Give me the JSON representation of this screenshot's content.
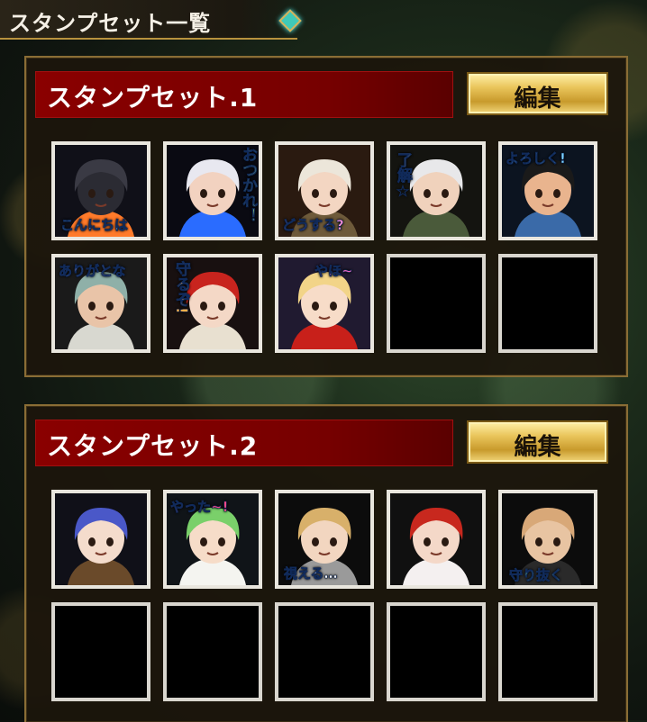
{
  "header": {
    "title": "スタンプセット一覧"
  },
  "sets": [
    {
      "title": "スタンプセット.1",
      "edit_label": "編集",
      "stamps": [
        {
          "text": "こんにちは",
          "text_color": "#7fd6ff",
          "hair": "#3a3a44",
          "skin": "#2b2b33",
          "accent": "#ff7a2a",
          "bg": "#101018",
          "icon": "armored-maid-icon"
        },
        {
          "text": "おつかれ！",
          "text_color": "#b7ff8a",
          "hair": "#e8e8f0",
          "skin": "#f2d2c0",
          "accent": "#2a6cff",
          "bg": "#0a0a12",
          "icon": "glasses-girl-icon"
        },
        {
          "text": "どうする?",
          "text_color": "#ff8fd6",
          "hair": "#ece6da",
          "skin": "#f3d6c2",
          "accent": "#6e5a3a",
          "bg": "#2a1a10",
          "icon": "goggles-girl-icon"
        },
        {
          "text": "了解☆",
          "text_color": "#ffd36a",
          "hair": "#e8e8ea",
          "skin": "#f0d2bc",
          "accent": "#4a5a3a",
          "bg": "#141410",
          "icon": "white-hair-boy-icon"
        },
        {
          "text": "よろしく!",
          "text_color": "#7fd6ff",
          "hair": "#1a1a1a",
          "skin": "#e9b48e",
          "accent": "#3a6aa8",
          "bg": "#0c1420",
          "icon": "thumbs-up-boy-icon"
        },
        {
          "text": "ありがとな",
          "text_color": "#e6c8ff",
          "hair": "#8fb0a8",
          "skin": "#e9c4a8",
          "accent": "#d8d8d0",
          "bg": "#1a1a1a",
          "icon": "grey-hair-man-icon"
        },
        {
          "text": "守るぞ!",
          "text_color": "#ffb04a",
          "hair": "#c8241e",
          "skin": "#f4d8c6",
          "accent": "#e8e0d0",
          "bg": "#181010",
          "icon": "horned-girl-icon"
        },
        {
          "text": "やほ~",
          "text_color": "#ff6ac8",
          "hair": "#f2d488",
          "skin": "#f7dcc8",
          "accent": "#c8201a",
          "bg": "#201a30",
          "icon": "blonde-girl-icon"
        },
        {
          "text": "",
          "text_color": "",
          "empty": true
        },
        {
          "text": "",
          "text_color": "",
          "empty": true
        }
      ]
    },
    {
      "title": "スタンプセット.2",
      "edit_label": "編集",
      "stamps": [
        {
          "text": "",
          "text_color": "#ffffff",
          "hair": "#4a58c8",
          "skin": "#f4dccc",
          "accent": "#6a4a2a",
          "bg": "#101018",
          "icon": "witch-girl-icon"
        },
        {
          "text": "やった~!",
          "text_color": "#ff4a8a",
          "hair": "#7ad06a",
          "skin": "#f6dcc8",
          "accent": "#f4f4f0",
          "bg": "#101418",
          "icon": "green-hair-girl-icon"
        },
        {
          "text": "視える…",
          "text_color": "#ffffff",
          "hair": "#d8b06a",
          "skin": "#f2d6c0",
          "accent": "#9a9a9a",
          "bg": "#0c0c0c",
          "icon": "hooded-boy-icon"
        },
        {
          "text": "",
          "text_color": "#ffffff",
          "hair": "#c8281e",
          "skin": "#f4d8c8",
          "accent": "#f4f0f0",
          "bg": "#101010",
          "icon": "red-hair-girl-icon"
        },
        {
          "text": "守り抜く",
          "text_color": "#9fff7a",
          "hair": "#d8a878",
          "skin": "#e8c4a2",
          "accent": "#2a2a2a",
          "bg": "#0c0c0c",
          "icon": "bald-warrior-icon"
        },
        {
          "text": "",
          "text_color": "",
          "empty": true
        },
        {
          "text": "",
          "text_color": "",
          "empty": true
        },
        {
          "text": "",
          "text_color": "",
          "empty": true
        },
        {
          "text": "",
          "text_color": "",
          "empty": true
        },
        {
          "text": "",
          "text_color": "",
          "empty": true
        }
      ]
    }
  ],
  "colors": {
    "banner_red": "#7a0000",
    "edit_gold": "#e2bb4a",
    "slot_border": "#e9e6de",
    "panel_border": "#8a6d35"
  }
}
